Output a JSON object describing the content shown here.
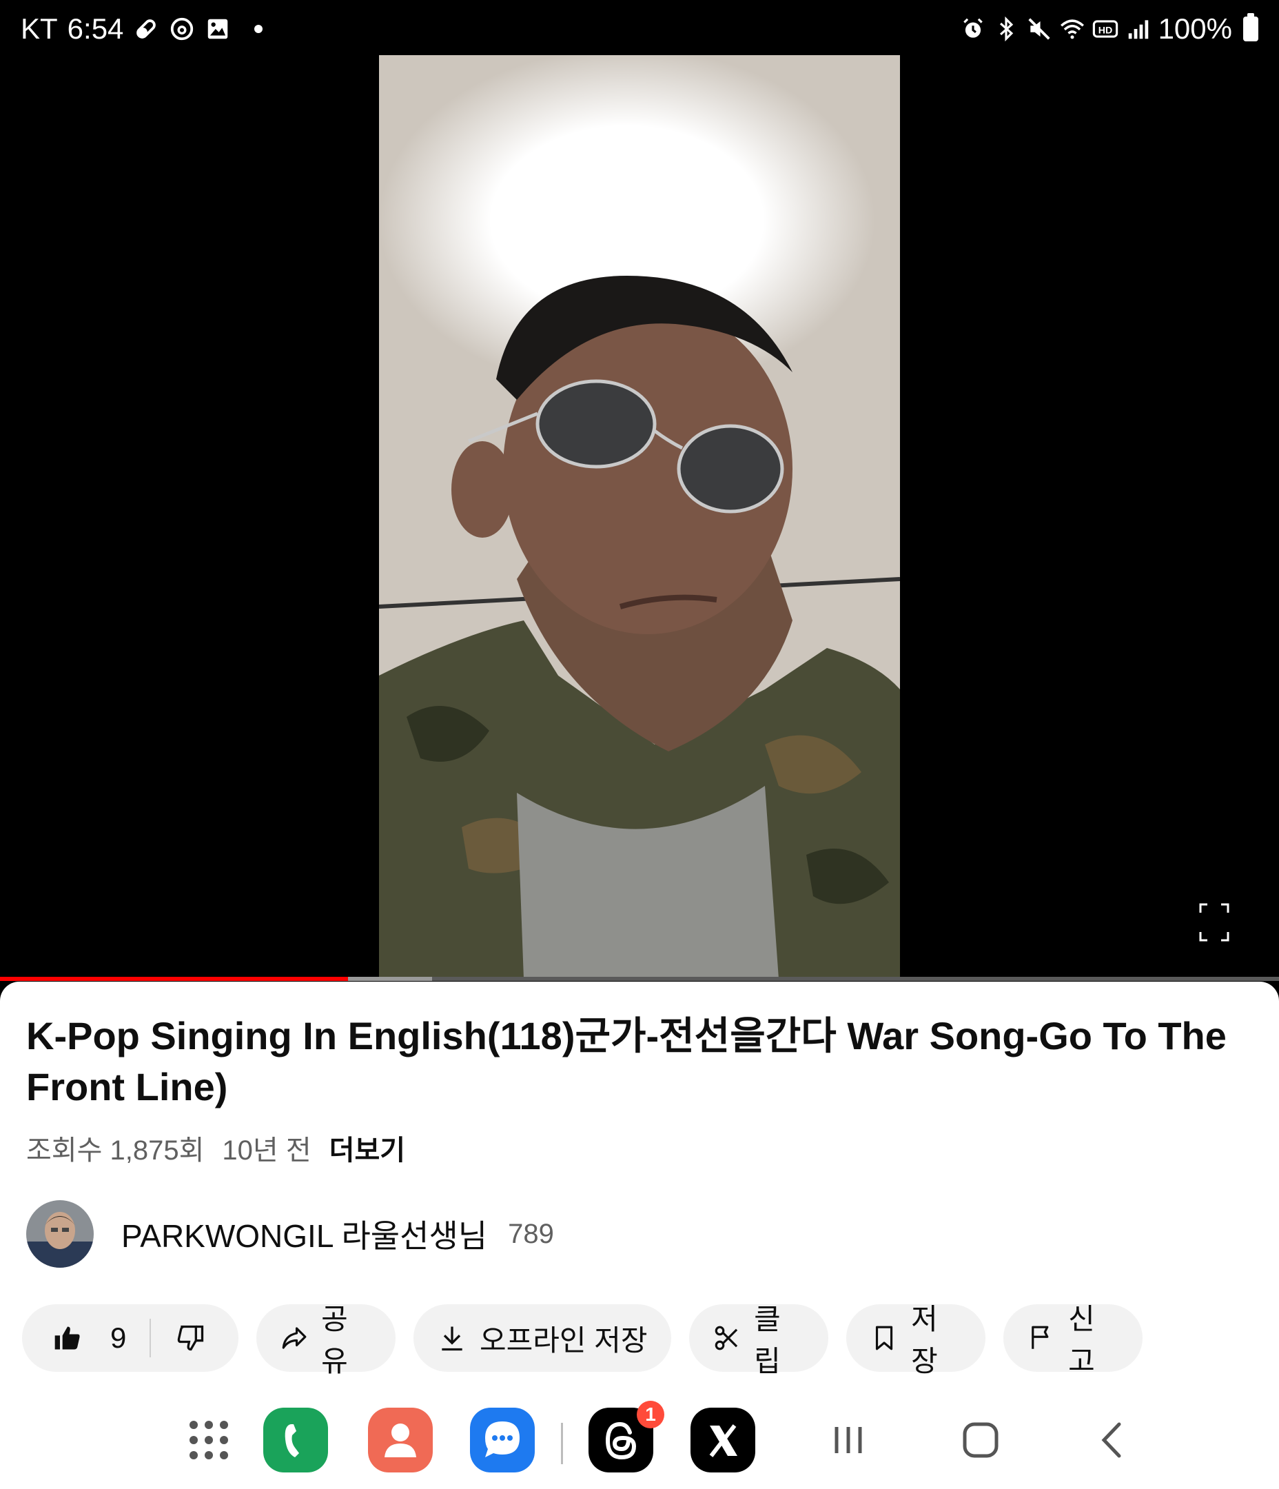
{
  "status_bar": {
    "carrier": "KT",
    "time": "6:54",
    "battery": "100%",
    "left_icons": [
      "pill-icon",
      "threads-icon",
      "gallery-icon"
    ],
    "right_icons": [
      "alarm-icon",
      "bluetooth-icon",
      "mute-icon",
      "wifi-icon",
      "hd-icon",
      "signal-icon",
      "battery-icon"
    ]
  },
  "video": {
    "progress_played_fraction": 0.272,
    "progress_buffered_fraction": 0.338
  },
  "details": {
    "title": "K-Pop Singing In English(118)군가-전선을간다 War Song-Go To The Front Line)",
    "views": "조회수 1,875회",
    "age": "10년 전",
    "more": "더보기"
  },
  "channel": {
    "name": "PARKWONGIL 라울선생님",
    "subscribers": "789"
  },
  "actions": {
    "like_count": "9",
    "share": "공유",
    "offline": "오프라인 저장",
    "clip": "클립",
    "save": "저장",
    "report": "신고"
  },
  "navbar": {
    "apps": [
      "apps-grid-icon",
      "phone-app-icon",
      "contacts-app-icon",
      "messages-app-icon",
      "threads-app-icon",
      "x-app-icon"
    ],
    "threads_badge": "1",
    "buttons": [
      "recents-icon",
      "home-icon",
      "back-icon"
    ]
  },
  "colors": {
    "progress": "#ff0000",
    "chip_bg": "#f2f2f2",
    "badge": "#ff4b3a"
  }
}
